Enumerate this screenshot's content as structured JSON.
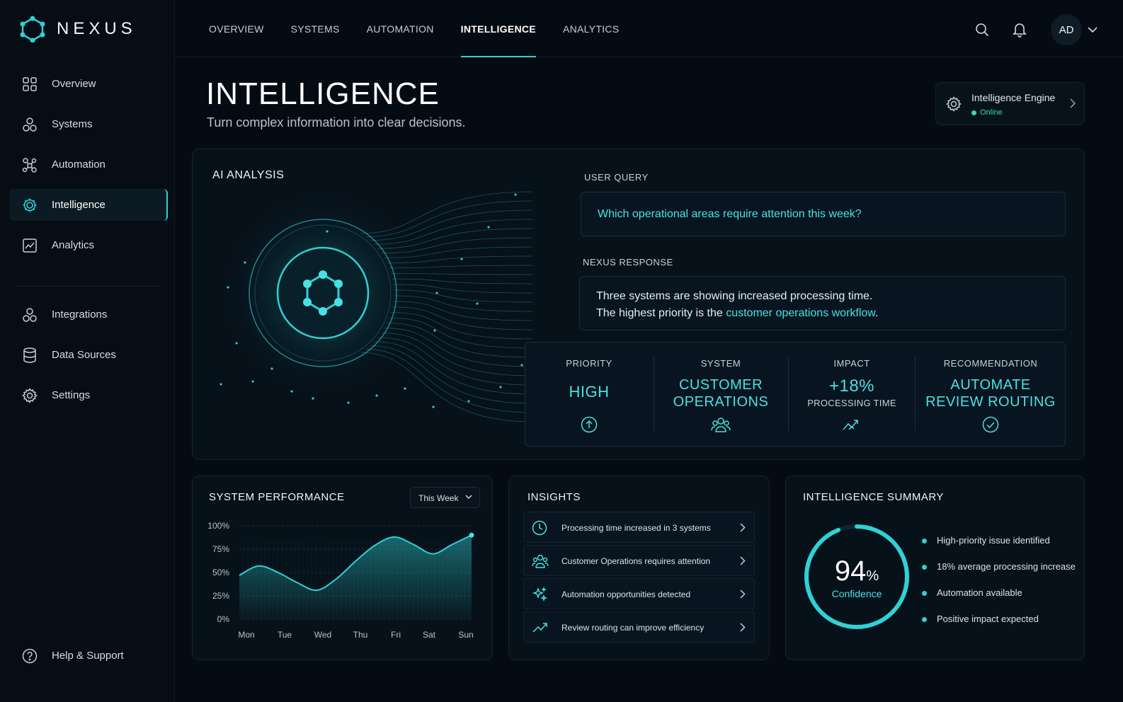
{
  "brand": {
    "name": "NEXUS"
  },
  "sidebar": {
    "items": [
      {
        "label": "Overview"
      },
      {
        "label": "Systems"
      },
      {
        "label": "Automation"
      },
      {
        "label": "Intelligence",
        "active": true
      },
      {
        "label": "Analytics"
      }
    ],
    "secondary": [
      {
        "label": "Integrations"
      },
      {
        "label": "Data Sources"
      },
      {
        "label": "Settings"
      }
    ],
    "help": "Help & Support"
  },
  "topnav": {
    "items": [
      {
        "label": "OVERVIEW"
      },
      {
        "label": "SYSTEMS"
      },
      {
        "label": "AUTOMATION"
      },
      {
        "label": "INTELLIGENCE",
        "active": true
      },
      {
        "label": "ANALYTICS"
      }
    ],
    "avatar": "AD"
  },
  "header": {
    "title": "INTELLIGENCE",
    "subtitle": "Turn complex information into clear decisions."
  },
  "engine": {
    "name": "Intelligence Engine",
    "status": "Online"
  },
  "ai": {
    "title": "AI ANALYSIS",
    "query_label": "USER QUERY",
    "query": "Which operational areas require attention this week?",
    "response_label": "NEXUS RESPONSE",
    "response_line1": "Three systems are showing increased processing time.",
    "response_line2_prefix": "The highest priority is the ",
    "response_highlight": "customer operations workflow",
    "response_suffix": ".",
    "metrics": {
      "priority": {
        "label": "PRIORITY",
        "value": "HIGH"
      },
      "system": {
        "label": "SYSTEM",
        "value_line1": "CUSTOMER",
        "value_line2": "OPERATIONS"
      },
      "impact": {
        "label": "IMPACT",
        "value": "+18%",
        "sub": "PROCESSING TIME"
      },
      "recommendation": {
        "label": "RECOMMENDATION",
        "value_line1": "AUTOMATE",
        "value_line2": "REVIEW ROUTING"
      }
    }
  },
  "performance": {
    "title": "SYSTEM PERFORMANCE",
    "range": "This Week"
  },
  "chart_data": {
    "type": "area",
    "categories": [
      "Mon",
      "Tue",
      "Wed",
      "Thu",
      "Fri",
      "Sat",
      "Sun"
    ],
    "x": [
      "Mon",
      "Mon.5",
      "Tue",
      "Tue.5",
      "Wed",
      "Wed.5",
      "Thu",
      "Thu.5",
      "Fri",
      "Fri.5",
      "Sat",
      "Sat.5",
      "Sun"
    ],
    "values": [
      47,
      57,
      50,
      39,
      31,
      43,
      62,
      79,
      88,
      80,
      70,
      80,
      90
    ],
    "ylim": [
      0,
      100
    ],
    "yticks": [
      "0%",
      "25%",
      "50%",
      "75%",
      "100%"
    ],
    "yticks_values": [
      0,
      25,
      50,
      75,
      100
    ],
    "grid": true,
    "color": "#2fd1d4"
  },
  "insights": {
    "title": "INSIGHTS",
    "items": [
      {
        "text": "Processing time increased in 3 systems",
        "icon": "clock-icon"
      },
      {
        "text": "Customer Operations requires attention",
        "icon": "users-icon"
      },
      {
        "text": "Automation opportunities detected",
        "icon": "sparkle-icon"
      },
      {
        "text": "Review routing can improve efficiency",
        "icon": "trend-up-icon"
      }
    ]
  },
  "summary": {
    "title": "INTELLIGENCE SUMMARY",
    "confidence": 94,
    "confidence_value": "94",
    "confidence_unit": "%",
    "confidence_label": "Confidence",
    "items": [
      {
        "text": "High-priority issue identified"
      },
      {
        "text": "18% average processing increase"
      },
      {
        "text": "Automation available"
      },
      {
        "text": "Positive impact expected"
      }
    ]
  },
  "colors": {
    "accent": "#2fd1d4",
    "background": "#050b12",
    "online": "#38d9a9"
  }
}
